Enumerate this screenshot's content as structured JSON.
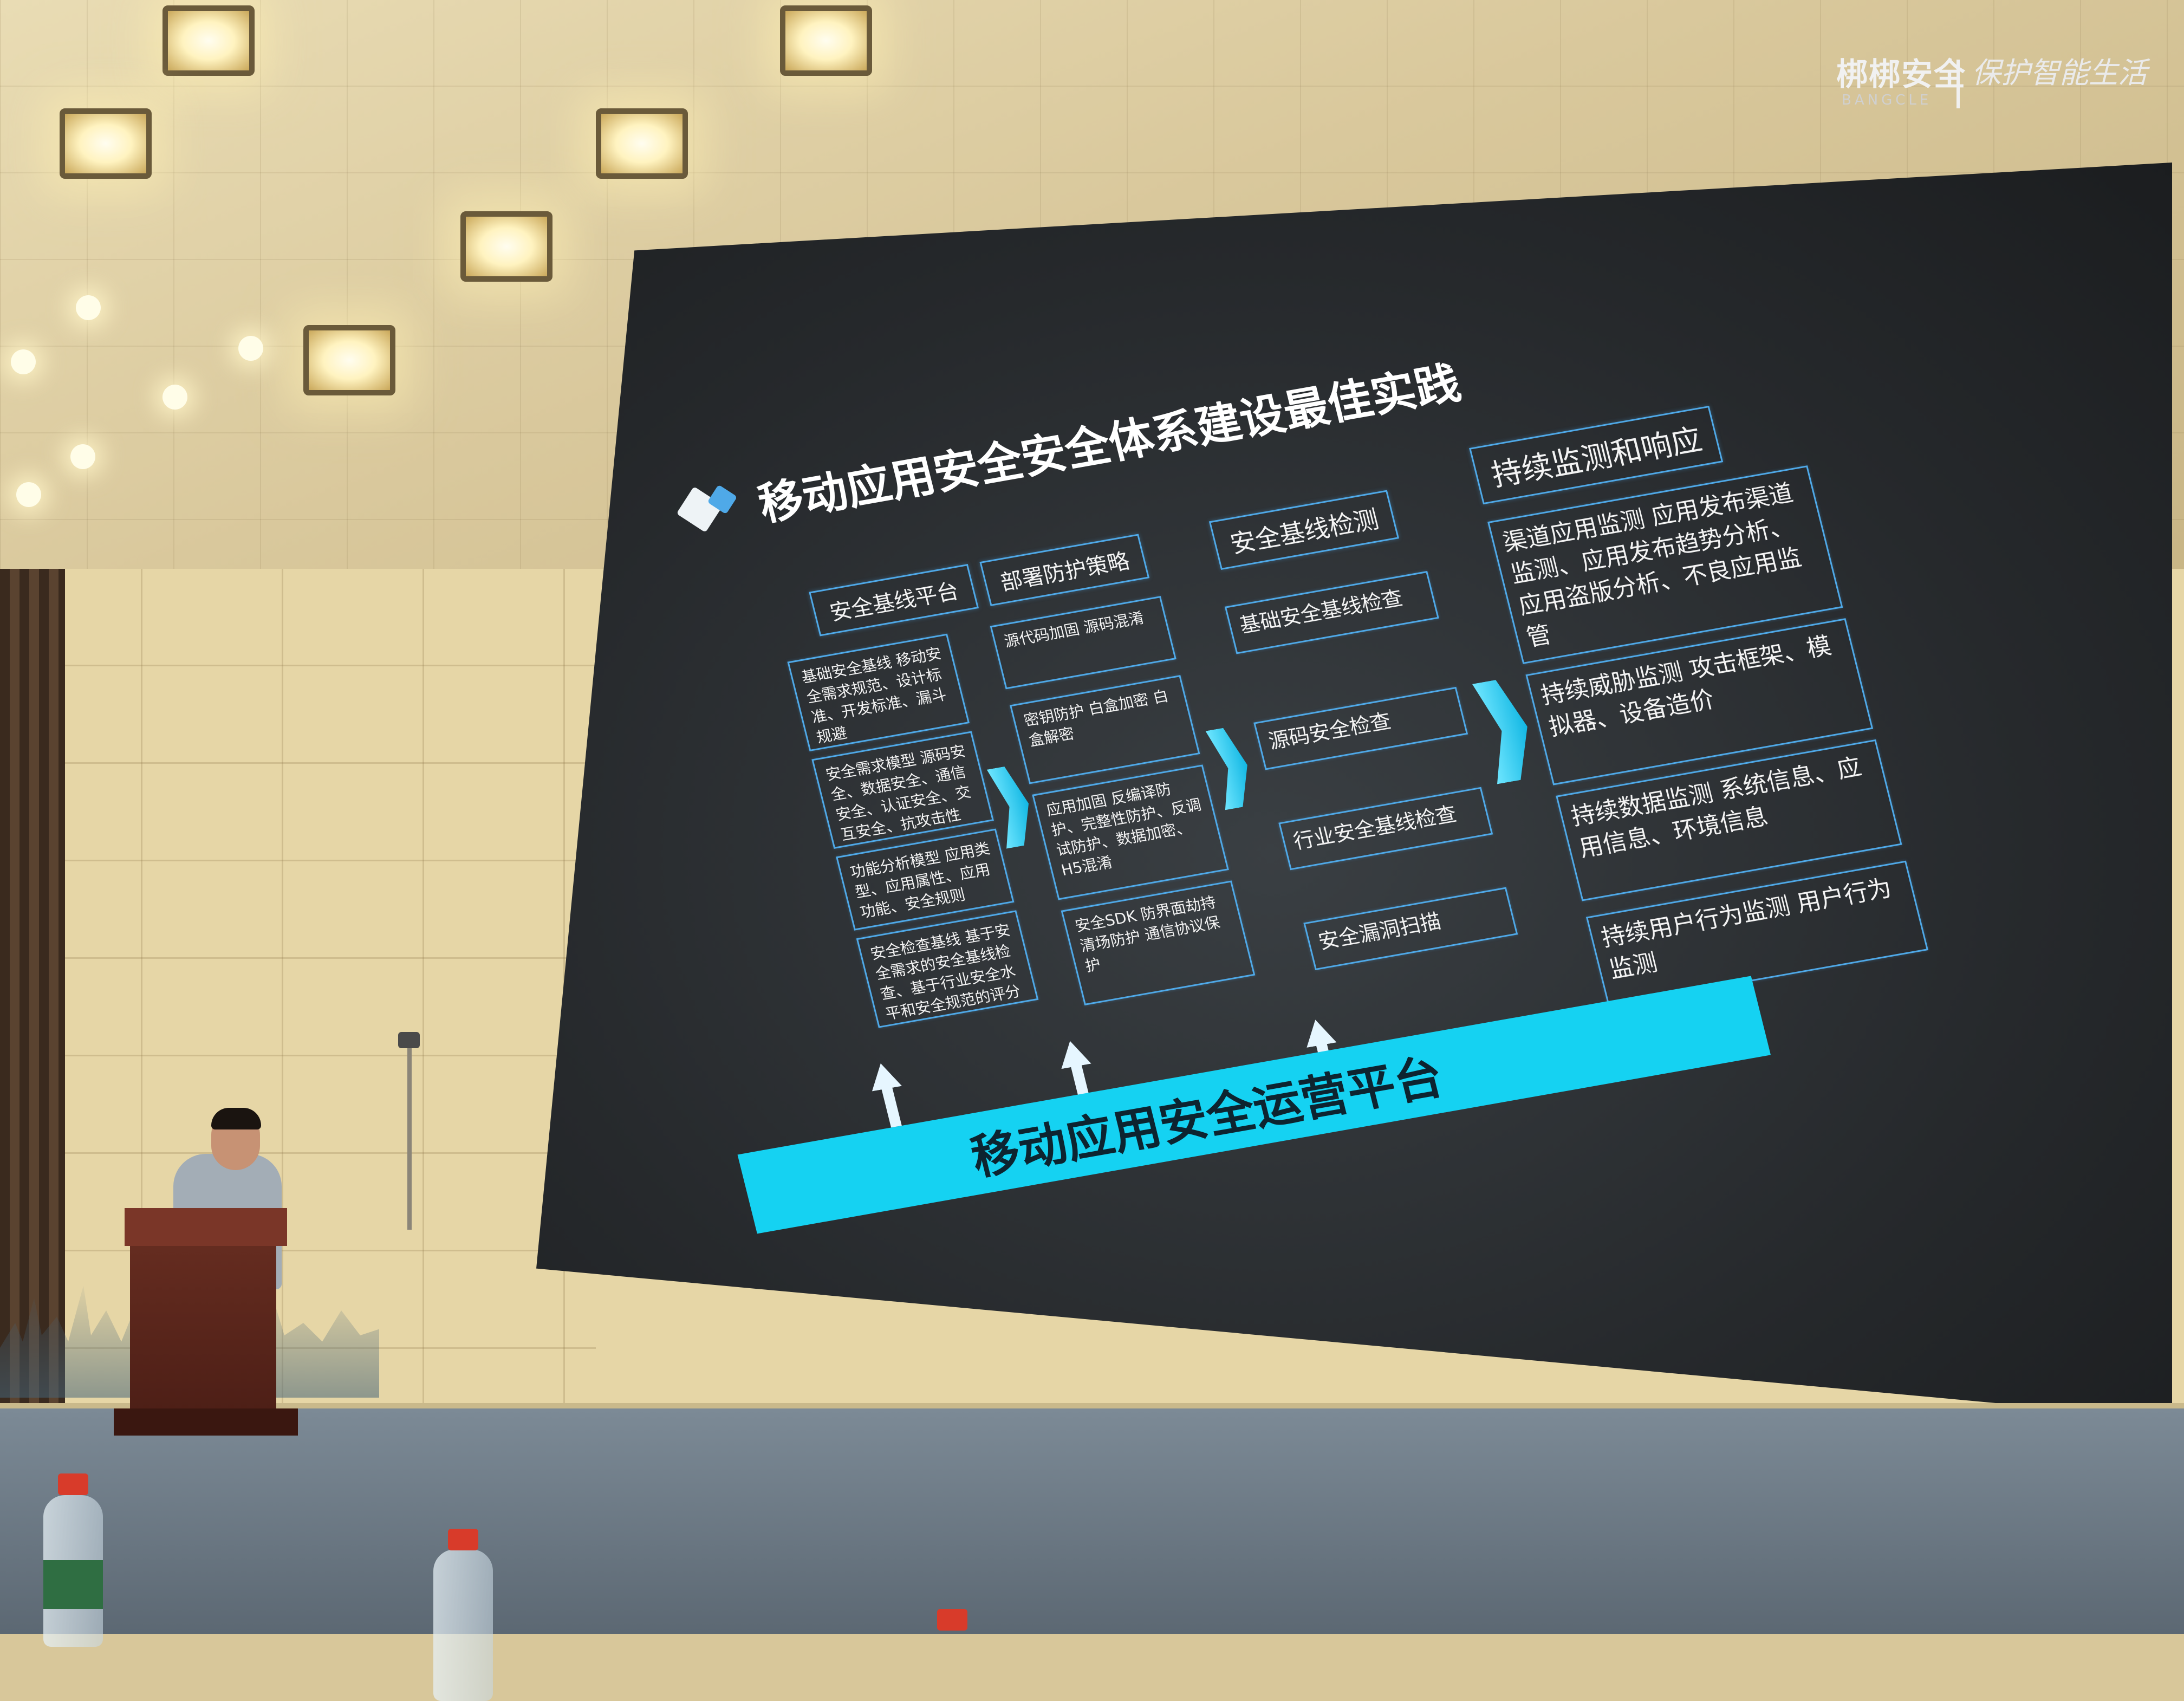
{
  "logo": {
    "brand": "梆梆安全",
    "brand_en": "BANGCLE",
    "slogan": "保护智能生活"
  },
  "slide": {
    "title": "移动应用安全安全体系建设最佳实践",
    "columns": [
      {
        "header": "安全基线平台",
        "boxes": [
          "基础安全基线 移动安全需求规范、设计标准、开发标准、漏斗规避",
          "安全需求模型 源码安全、数据安全、通信安全、认证安全、交互安全、抗攻击性",
          "功能分析模型 应用类型、应用属性、应用功能、安全规则",
          "安全检查基线 基于安全需求的安全基线检查、基于行业安全水平和安全规范的评分"
        ]
      },
      {
        "header": "部署防护策略",
        "boxes": [
          "源代码加固 源码混淆",
          "密钥防护 白盒加密 白盒解密",
          "应用加固 反编译防护、完整性防护、反调试防护、数据加密、H5混淆",
          "安全SDK 防界面劫持 清场防护 通信协议保护"
        ]
      },
      {
        "header": "安全基线检测",
        "boxes": [
          "基础安全基线检查",
          "源码安全检查",
          "行业安全基线检查",
          "安全漏洞扫描"
        ]
      },
      {
        "header": "持续监测和响应",
        "boxes": [
          "渠道应用监测 应用发布渠道监测、应用发布趋势分析、应用盗版分析、不良应用监管",
          "持续威胁监测 攻击框架、模拟器、设备造价",
          "持续数据监测 系统信息、应用信息、环境信息",
          "持续用户行为监测 用户行为监测"
        ]
      }
    ],
    "platform_label": "移动应用安全运营平台"
  },
  "colors": {
    "accent_cyan": "#15d2f2",
    "box_border": "#4fa9e8",
    "screen_bg": "#26292c",
    "podium": "#5a241a"
  }
}
